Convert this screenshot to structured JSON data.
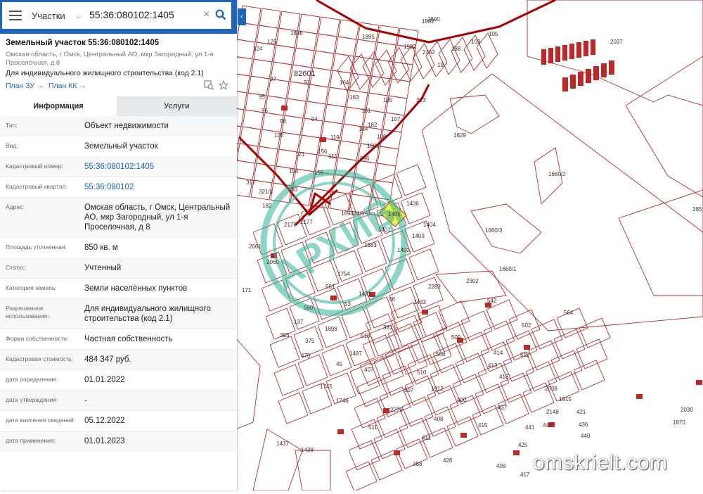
{
  "search": {
    "type_label": "Участки",
    "value": "55:36:080102:1405"
  },
  "parcel": {
    "title": "Земельный участок 55:36:080102:1405",
    "address_short": "Омская область, г Омск, Центральный АО, мкр Загородный, ул 1-я Проселочная, д 8",
    "use": "Для индивидуального жилищного строительства (код 2.1)",
    "link_plan_zu": "План ЗУ →",
    "link_plan_kk": "План КК →"
  },
  "tabs": [
    "Информация",
    "Услуги"
  ],
  "rows": [
    {
      "label": "Тип:",
      "value": "Объект недвижимости"
    },
    {
      "label": "Вид:",
      "value": "Земельный участок"
    },
    {
      "label": "Кадастровый номер:",
      "value": "55:36:080102:1405"
    },
    {
      "label": "Кадастровый квартал:",
      "value": "55:36:080102"
    },
    {
      "label": "Адрес:",
      "value": "Омская область, г Омск, Центральный АО, мкр Загородный, ул 1-я Проселочная, д 8"
    },
    {
      "label": "Площадь уточненная:",
      "value": "850 кв. м"
    },
    {
      "label": "Статус:",
      "value": "Учтенный"
    },
    {
      "label": "Категория земель:",
      "value": "Земли населённых пунктов"
    },
    {
      "label": "Разрешенное использование:",
      "value": "Для индивидуального жилищного строительства (код 2.1)"
    },
    {
      "label": "Форма собственности:",
      "value": "Частная собственность"
    },
    {
      "label": "Кадастровая стоимость:",
      "value": "484 347 руб."
    },
    {
      "label": "дата определения:",
      "value": "01.01.2022"
    },
    {
      "label": "дата утверждения:",
      "value": "-"
    },
    {
      "label": "дата внесения сведений:",
      "value": "05.12.2022"
    },
    {
      "label": "дата применения:",
      "value": "01.01.2023"
    }
  ],
  "map_labels": [
    "1982",
    "2037",
    "82601",
    "1829",
    "169421/1",
    "1660/2",
    "1660/3",
    "1660/1",
    "385",
    "564",
    "2302",
    "542",
    "1405",
    "1406",
    "1404",
    "1403",
    "1402",
    "1883",
    "1401",
    "1433",
    "2283",
    "381",
    "1487",
    "513",
    "407",
    "1745",
    "1746",
    "510",
    "507",
    "508",
    "509",
    "511",
    "2279",
    "1912",
    "400",
    "408",
    "411",
    "415",
    "437",
    "418",
    "413",
    "414",
    "512",
    "502",
    "2038",
    "2148",
    "1915",
    "421",
    "436",
    "440",
    "441",
    "443",
    "425",
    "426",
    "388",
    "409",
    "417",
    "1437",
    "1438",
    "2030",
    "1870",
    "1690",
    "2162",
    "1982",
    "19",
    "188",
    "103",
    "105",
    "107",
    "108",
    "1000",
    "896",
    "313",
    "317",
    "321/1",
    "182",
    "183",
    "2178",
    "2177",
    "2060",
    "2061",
    "171",
    "1754",
    "1431",
    "53",
    "561",
    "560",
    "137",
    "1898",
    "375",
    "383",
    "478",
    "45",
    "46",
    "1886",
    "1895",
    "115",
    "119",
    "120",
    "121",
    "124",
    "125",
    "93",
    "94",
    "95",
    "96",
    "97",
    "98",
    "154",
    "155",
    "156",
    "161",
    "163",
    "164",
    "182",
    "184",
    "185",
    "324",
    "311",
    "1",
    "2",
    "5",
    "7",
    "9",
    "11",
    "12"
  ],
  "watermark": "omskrielt.com",
  "colors": {
    "accent": "#1f66b8",
    "parcel_line": "#b03030",
    "quarter_line": "#b00000",
    "selected_fill": "#f5f03a",
    "stamp": "#2fb59a"
  }
}
